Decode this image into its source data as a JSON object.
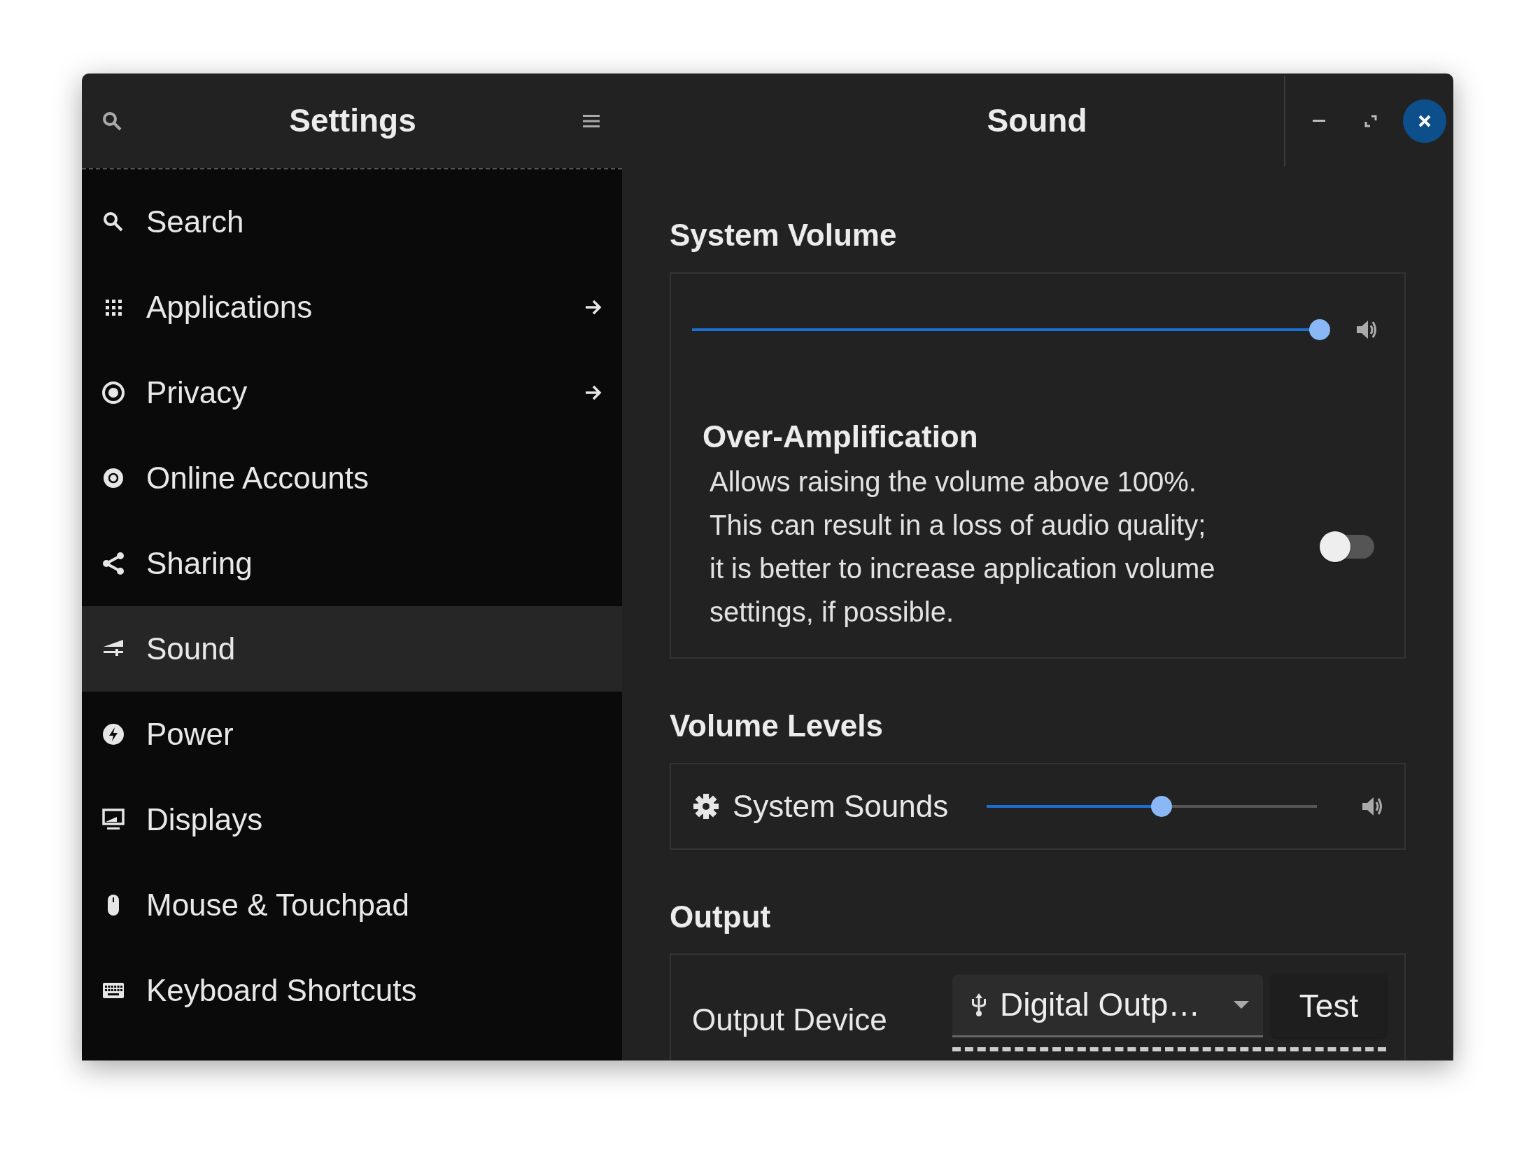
{
  "sidebar": {
    "title": "Settings",
    "items": [
      {
        "label": "Search",
        "selected": false,
        "arrow": false
      },
      {
        "label": "Applications",
        "selected": false,
        "arrow": true
      },
      {
        "label": "Privacy",
        "selected": false,
        "arrow": true
      },
      {
        "label": "Online Accounts",
        "selected": false,
        "arrow": false
      },
      {
        "label": "Sharing",
        "selected": false,
        "arrow": false
      },
      {
        "label": "Sound",
        "selected": true,
        "arrow": false
      },
      {
        "label": "Power",
        "selected": false,
        "arrow": false
      },
      {
        "label": "Displays",
        "selected": false,
        "arrow": false
      },
      {
        "label": "Mouse & Touchpad",
        "selected": false,
        "arrow": false
      },
      {
        "label": "Keyboard Shortcuts",
        "selected": false,
        "arrow": false
      }
    ]
  },
  "page": {
    "title": "Sound"
  },
  "system_volume": {
    "heading": "System Volume",
    "level": 1.0,
    "over_amplification": {
      "title": "Over-Amplification",
      "description_lines": [
        "Allows raising the volume above 100%.",
        "This can result in a loss of audio quality;",
        "it is better to increase application volume",
        "settings, if possible."
      ],
      "on": false
    }
  },
  "volume_levels": {
    "heading": "Volume Levels",
    "items": [
      {
        "label": "System Sounds",
        "level": 0.53
      }
    ]
  },
  "output": {
    "heading": "Output",
    "device_label": "Output Device",
    "device_value": "Digital Outp…",
    "test_button": "Test"
  }
}
